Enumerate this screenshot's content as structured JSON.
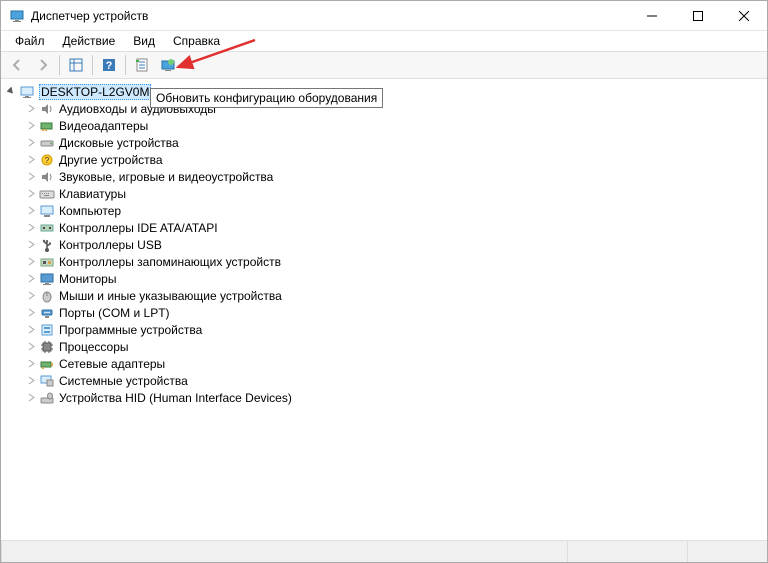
{
  "window": {
    "title": "Диспетчер устройств"
  },
  "menu": {
    "file": "Файл",
    "action": "Действие",
    "view": "Вид",
    "help": "Справка"
  },
  "tooltip": "Обновить конфигурацию оборудования",
  "tree": {
    "root": "DESKTOP-L2GV0M",
    "items": [
      "Аудиовходы и аудиовыходы",
      "Видеоадаптеры",
      "Дисковые устройства",
      "Другие устройства",
      "Звуковые, игровые и видеоустройства",
      "Клавиатуры",
      "Компьютер",
      "Контроллеры IDE ATA/ATAPI",
      "Контроллеры USB",
      "Контроллеры запоминающих устройств",
      "Мониторы",
      "Мыши и иные указывающие устройства",
      "Порты (COM и LPT)",
      "Программные устройства",
      "Процессоры",
      "Сетевые адаптеры",
      "Системные устройства",
      "Устройства HID (Human Interface Devices)"
    ]
  }
}
